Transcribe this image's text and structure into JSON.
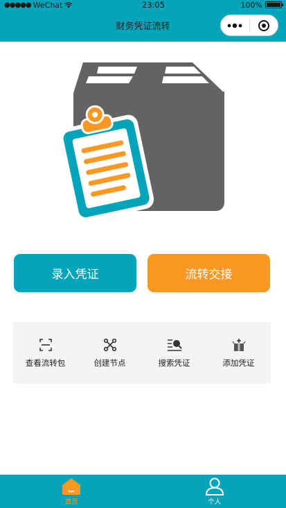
{
  "status_bar": {
    "carrier": "WeChat",
    "time": "23:05",
    "battery": "100%"
  },
  "nav": {
    "title": "财务凭证流转"
  },
  "buttons": {
    "entry": "录入凭证",
    "transfer": "流转交接"
  },
  "actions": [
    {
      "label": "查看流转包",
      "icon": "scan-icon"
    },
    {
      "label": "创建节点",
      "icon": "nodes-icon"
    },
    {
      "label": "搜索凭证",
      "icon": "search-list-icon"
    },
    {
      "label": "添加凭证",
      "icon": "add-box-icon"
    }
  ],
  "tabs": {
    "home": "首页",
    "me": "个人"
  },
  "colors": {
    "primary": "#04a5ba",
    "accent": "#fb9723",
    "box": "#636364"
  }
}
